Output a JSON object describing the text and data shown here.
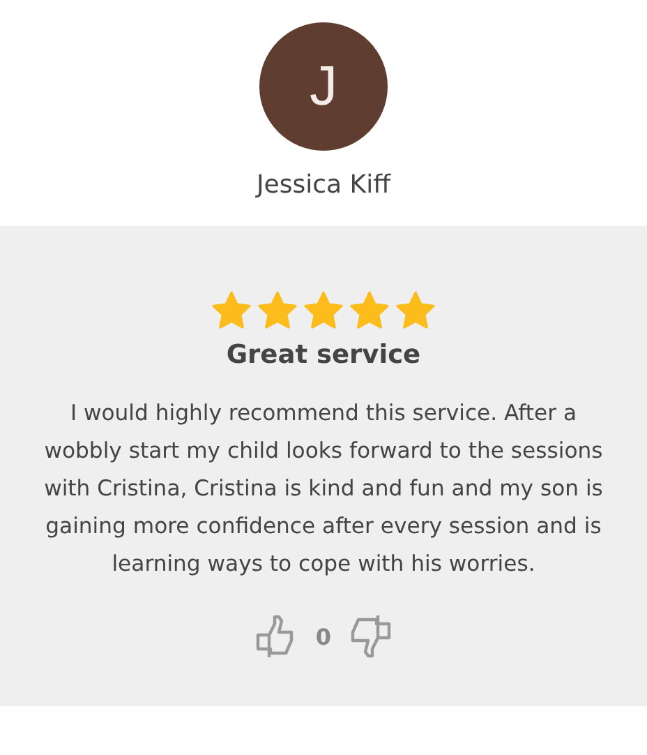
{
  "reviewer": {
    "initial": "J",
    "name": "Jessica Kiff"
  },
  "review": {
    "stars": 5,
    "title": "Great service",
    "body": "I would highly recommend this service. After a wobbly start my child looks forward to the sessions with Cristina, Cristina is kind and fun and my son is gaining more confidence after every session and is learning ways to cope with his worries.",
    "votes": "0"
  }
}
